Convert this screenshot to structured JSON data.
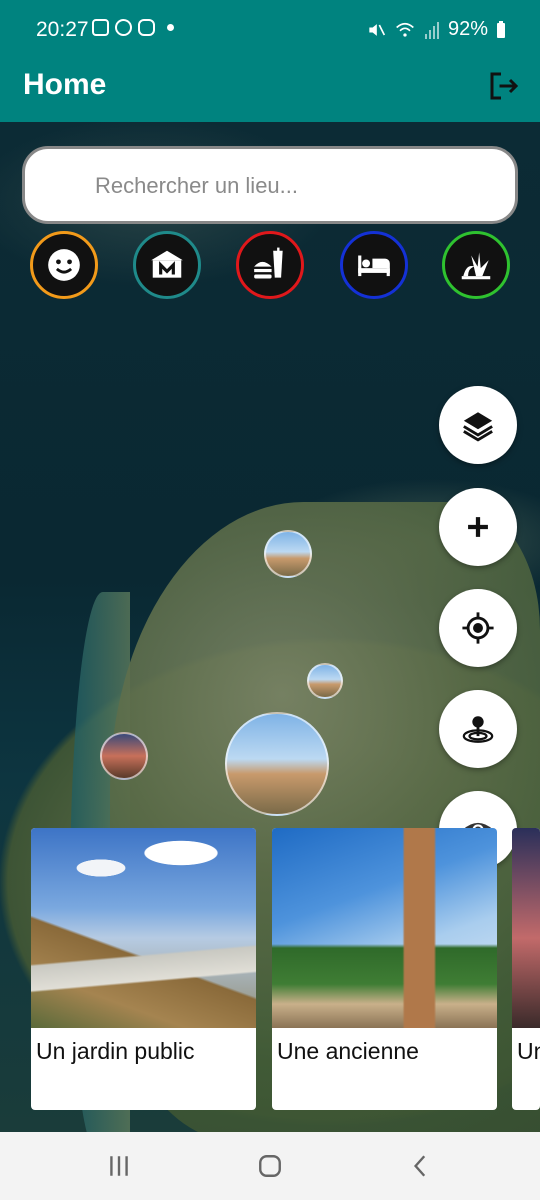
{
  "status_bar": {
    "time": "20:27",
    "battery": "92%",
    "icons": [
      "image-icon",
      "shield-icon",
      "cast-icon",
      "dot-icon",
      "mute-icon",
      "wifi-icon",
      "signal-icon",
      "battery-icon"
    ]
  },
  "app_bar": {
    "title": "Home",
    "logout_icon": "logout-icon"
  },
  "search": {
    "placeholder": "Rechercher un lieu...",
    "value": ""
  },
  "categories": [
    {
      "icon": "smiley-icon",
      "color": "#f29a1a"
    },
    {
      "icon": "museum-icon",
      "color": "#1f8a8a"
    },
    {
      "icon": "food-icon",
      "color": "#e0181b"
    },
    {
      "icon": "hotel-icon",
      "color": "#1431d6"
    },
    {
      "icon": "nature-icon",
      "color": "#2fc22f"
    }
  ],
  "fabs": [
    "layers-icon",
    "zoom-in-icon",
    "my-location-icon",
    "radar-icon",
    "visibility-icon"
  ],
  "places": [
    {
      "label": "Un jardin public"
    },
    {
      "label": "Une ancienne"
    },
    {
      "label": "Un"
    }
  ],
  "nav_bar": [
    "recent-apps-icon",
    "home-icon",
    "back-icon"
  ],
  "colors": {
    "primary": "#00837f",
    "fab_bg": "#ffffff"
  }
}
